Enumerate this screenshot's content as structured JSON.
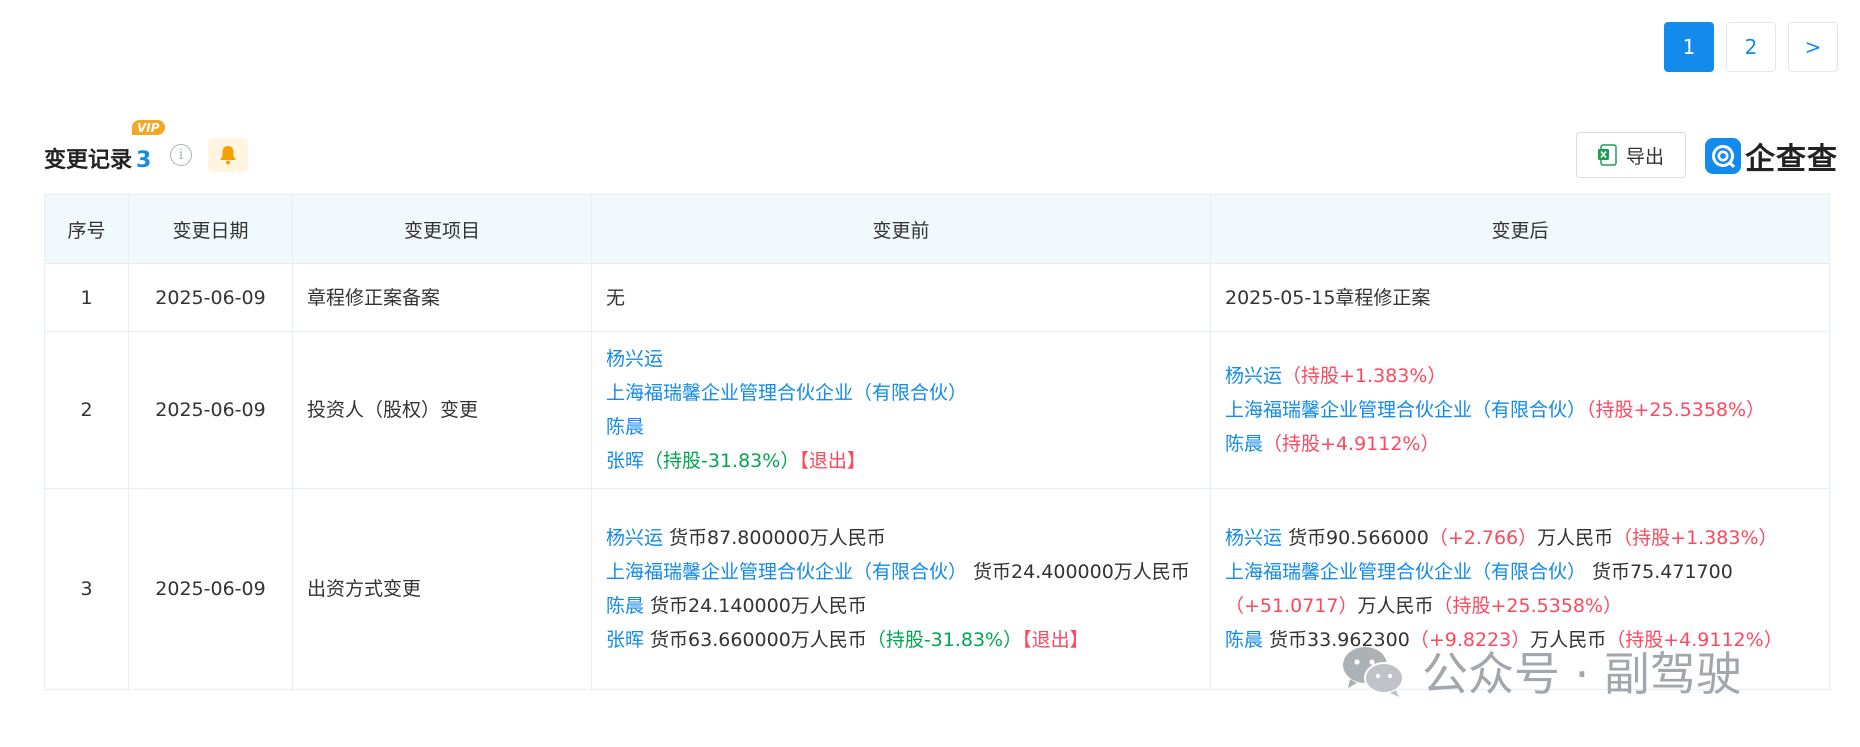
{
  "pagination": {
    "pages": [
      "1",
      "2"
    ],
    "next": ">"
  },
  "section": {
    "vip_badge": "VIP",
    "title": "变更记录",
    "count": "3",
    "export_label": "导出",
    "logo_text": "企查查"
  },
  "table": {
    "headers": [
      "序号",
      "变更日期",
      "变更项目",
      "变更前",
      "变更后"
    ],
    "rows": [
      {
        "index": "1",
        "date": "2025-06-09",
        "item": "章程修正案备案",
        "before": [
          [
            {
              "t": "无",
              "c": "plain"
            }
          ]
        ],
        "after": [
          [
            {
              "t": "2025-05-15章程修正案",
              "c": "plain"
            }
          ]
        ]
      },
      {
        "index": "2",
        "date": "2025-06-09",
        "item": "投资人（股权）变更",
        "before": [
          [
            {
              "t": "杨兴运",
              "c": "blue"
            }
          ],
          [
            {
              "t": "上海福瑞馨企业管理合伙企业（有限合伙）",
              "c": "blue"
            }
          ],
          [
            {
              "t": "陈晨",
              "c": "blue"
            }
          ],
          [
            {
              "t": "张晖",
              "c": "blue"
            },
            {
              "t": "（持股-31.83%）",
              "c": "green"
            },
            {
              "t": "【退出】",
              "c": "red"
            }
          ]
        ],
        "after": [
          [
            {
              "t": "杨兴运",
              "c": "blue"
            },
            {
              "t": "（持股+1.383%）",
              "c": "red"
            }
          ],
          [
            {
              "t": "上海福瑞馨企业管理合伙企业（有限合伙）",
              "c": "blue"
            },
            {
              "t": "（持股+25.5358%）",
              "c": "red"
            }
          ],
          [
            {
              "t": "陈晨",
              "c": "blue"
            },
            {
              "t": "（持股+4.9112%）",
              "c": "red"
            }
          ]
        ]
      },
      {
        "index": "3",
        "date": "2025-06-09",
        "item": "出资方式变更",
        "before": [
          [
            {
              "t": "杨兴运",
              "c": "blue"
            },
            {
              "t": " 货币87.800000万人民币",
              "c": "plain"
            }
          ],
          [
            {
              "t": "上海福瑞馨企业管理合伙企业（有限合伙）",
              "c": "blue"
            },
            {
              "t": " 货币24.400000万人民币",
              "c": "plain"
            }
          ],
          [
            {
              "t": "陈晨",
              "c": "blue"
            },
            {
              "t": " 货币24.140000万人民币",
              "c": "plain"
            }
          ],
          [
            {
              "t": "张晖",
              "c": "blue"
            },
            {
              "t": " 货币63.660000万人民币",
              "c": "plain"
            },
            {
              "t": "（持股-31.83%）",
              "c": "green"
            },
            {
              "t": "【退出】",
              "c": "red"
            }
          ]
        ],
        "after": [
          [
            {
              "t": "杨兴运",
              "c": "blue"
            },
            {
              "t": " 货币90.566000",
              "c": "plain"
            },
            {
              "t": "（+2.766）",
              "c": "red"
            },
            {
              "t": "万人民币",
              "c": "plain"
            },
            {
              "t": "（持股+1.383%）",
              "c": "red"
            }
          ],
          [
            {
              "t": "上海福瑞馨企业管理合伙企业（有限合伙）",
              "c": "blue"
            },
            {
              "t": " 货币75.471700",
              "c": "plain"
            },
            {
              "t": "（+51.0717）",
              "c": "red"
            },
            {
              "t": "万人民币",
              "c": "plain"
            },
            {
              "t": "（持股+25.5358%）",
              "c": "red"
            }
          ],
          [
            {
              "t": "陈晨",
              "c": "blue"
            },
            {
              "t": " 货币33.962300",
              "c": "plain"
            },
            {
              "t": "（+9.8223）",
              "c": "red"
            },
            {
              "t": "万人民币",
              "c": "plain"
            },
            {
              "t": "（持股+4.9112%）",
              "c": "red"
            }
          ]
        ]
      }
    ]
  },
  "watermark": {
    "text": "公众号 · 副驾驶"
  },
  "colors": {
    "accent": "#128bed",
    "red": "#fd485e",
    "green": "#00a74e",
    "header_bg": "#f2f9fc"
  }
}
